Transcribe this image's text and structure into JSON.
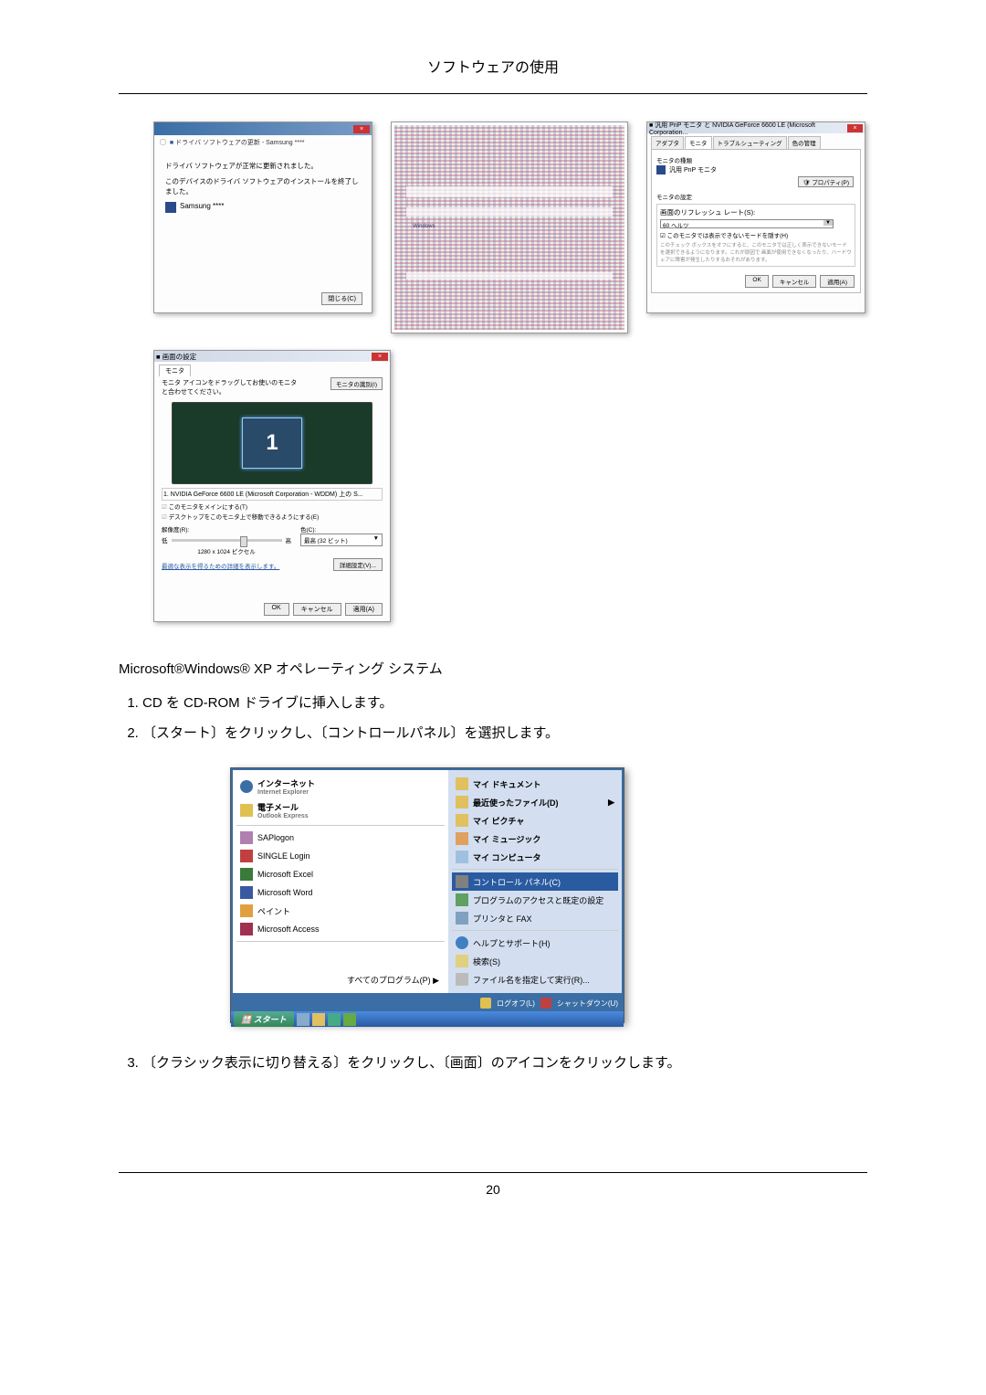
{
  "page_header": "ソフトウェアの使用",
  "page_number": "20",
  "dlg1": {
    "crumb": "ドライバ ソフトウェアの更新 - Samsung ****",
    "msg1": "ドライバ ソフトウェアが正常に更新されました。",
    "msg2": "このデバイスのドライバ ソフトウェアのインストールを終了しました。",
    "monitor": "Samsung ****",
    "close_btn": "閉じる(C)"
  },
  "dlg3": {
    "title": "汎用 PnP モニタ と NVIDIA GeForce 6600 LE (Microsoft Corporation...",
    "tabs": [
      "アダプタ",
      "モニタ",
      "トラブルシューティング",
      "色の管理"
    ],
    "type_label": "モニタの種類",
    "monitor_name": "汎用 PnP モニタ",
    "prop_btn": "プロパティ(P)",
    "settings_label": "モニタの設定",
    "refresh_label": "画面のリフレッシュ レート(S):",
    "refresh_value": "60 ヘルツ",
    "chk": "このモニタでは表示できないモードを隠す(H)",
    "note": "このチェック ボックスをオフにすると、このモニタでは正しく表示できないモードを選択できるようになります。これが原因で 画面が使用できなくなったり、ハードウェアに障害が発生したりするおそれがあります。",
    "ok": "OK",
    "cancel": "キャンセル",
    "apply": "適用(A)"
  },
  "dlg4": {
    "title": "画面の設定",
    "tab": "モニタ",
    "msg": "モニタ アイコンをドラッグしてお使いのモニタと合わせてください。",
    "identify_btn": "モニタの識別(I)",
    "big_num": "1",
    "display_list": "1. NVIDIA GeForce 6600 LE (Microsoft Corporation - WDDM) 上の S...",
    "chk1": "このモニタをメインにする(T)",
    "chk2": "デスクトップをこのモニタ上で移動できるようにする(E)",
    "res_label": "解像度(R):",
    "res_low": "低",
    "res_high": "高",
    "res_value": "1280 x 1024 ピクセル",
    "color_label": "色(C):",
    "color_value": "最高 (32 ビット)",
    "link": "最適な表示を得るための詳細を表示します。",
    "adv_btn": "詳細設定(V)...",
    "ok": "OK",
    "cancel": "キャンセル",
    "apply": "適用(A)"
  },
  "body_text": "Microsoft®Windows® XP オペレーティング システム",
  "li1": "CD を CD-ROM ドライブに挿入します。",
  "li2": "〔スタート〕をクリックし、〔コントロールパネル〕を選択します。",
  "li3": "〔クラシック表示に切り替える〕をクリックし、〔画面〕のアイコンをクリックします。",
  "sm": {
    "left": {
      "ie": "インターネット",
      "ie_sub": "Internet Explorer",
      "mail": "電子メール",
      "mail_sub": "Outlook Express",
      "sap": "SAPlogon",
      "single": "SINGLE Login",
      "excel": "Microsoft Excel",
      "word": "Microsoft Word",
      "paint": "ペイント",
      "access": "Microsoft Access",
      "all": "すべてのプログラム(P)"
    },
    "right": {
      "mydoc": "マイ ドキュメント",
      "recent": "最近使ったファイル(D)",
      "mypic": "マイ ピクチャ",
      "mymusic": "マイ ミュージック",
      "mycomp": "マイ コンピュータ",
      "cpl": "コントロール パネル(C)",
      "prog": "プログラムのアクセスと既定の設定",
      "printer": "プリンタと FAX",
      "help": "ヘルプとサポート(H)",
      "search": "検索(S)",
      "run": "ファイル名を指定して実行(R)...",
      "logoff": "ログオフ(L)",
      "shutdown": "シャットダウン(U)"
    },
    "start_btn": "スタート"
  }
}
